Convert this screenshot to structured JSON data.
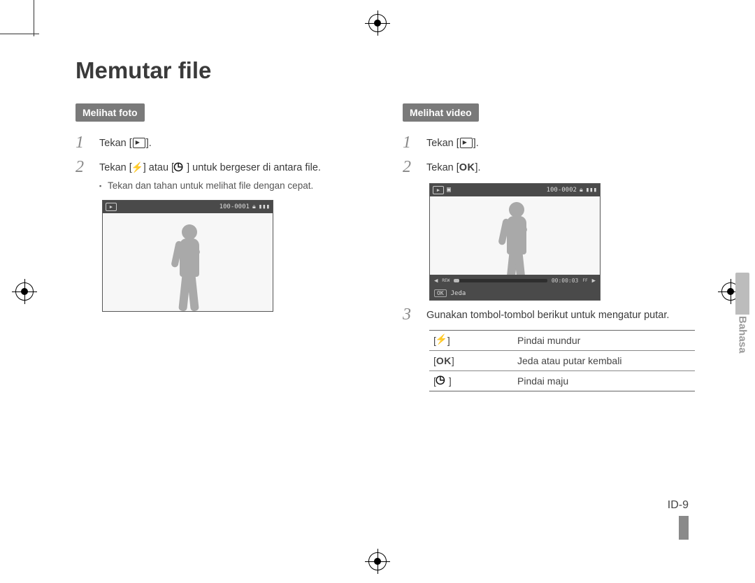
{
  "title": "Memutar file",
  "side_label": "Bahasa",
  "page_number": "ID-9",
  "left": {
    "heading": "Melihat foto",
    "step1": {
      "prefix": "Tekan [",
      "icon": "playback",
      "suffix": "]."
    },
    "step2": {
      "prefix": "Tekan [",
      "icon1": "flash",
      "mid": "] atau [",
      "icon2": "timer",
      "suffix": "] untuk bergeser di antara file.",
      "sub": "Tekan dan tahan untuk melihat file dengan cepat."
    },
    "screenshot": {
      "counter": "100-0001"
    }
  },
  "right": {
    "heading": "Melihat video",
    "step1": {
      "prefix": "Tekan [",
      "icon": "playback",
      "suffix": "]."
    },
    "step2": {
      "prefix": "Tekan [",
      "ok": "OK",
      "suffix": "]."
    },
    "step3": "Gunakan tombol-tombol berikut untuk mengatur putar.",
    "screenshot": {
      "counter": "100-0002",
      "time": "00:00:03",
      "ok": "OK",
      "pause_label": "Jeda",
      "rew": "REW",
      "ff": "FF"
    },
    "table": {
      "r1": {
        "icon": "flash",
        "desc": "Pindai mundur"
      },
      "r2": {
        "ok": "OK",
        "desc": "Jeda atau putar kembali"
      },
      "r3": {
        "icon": "timer",
        "desc": "Pindai maju"
      }
    }
  }
}
